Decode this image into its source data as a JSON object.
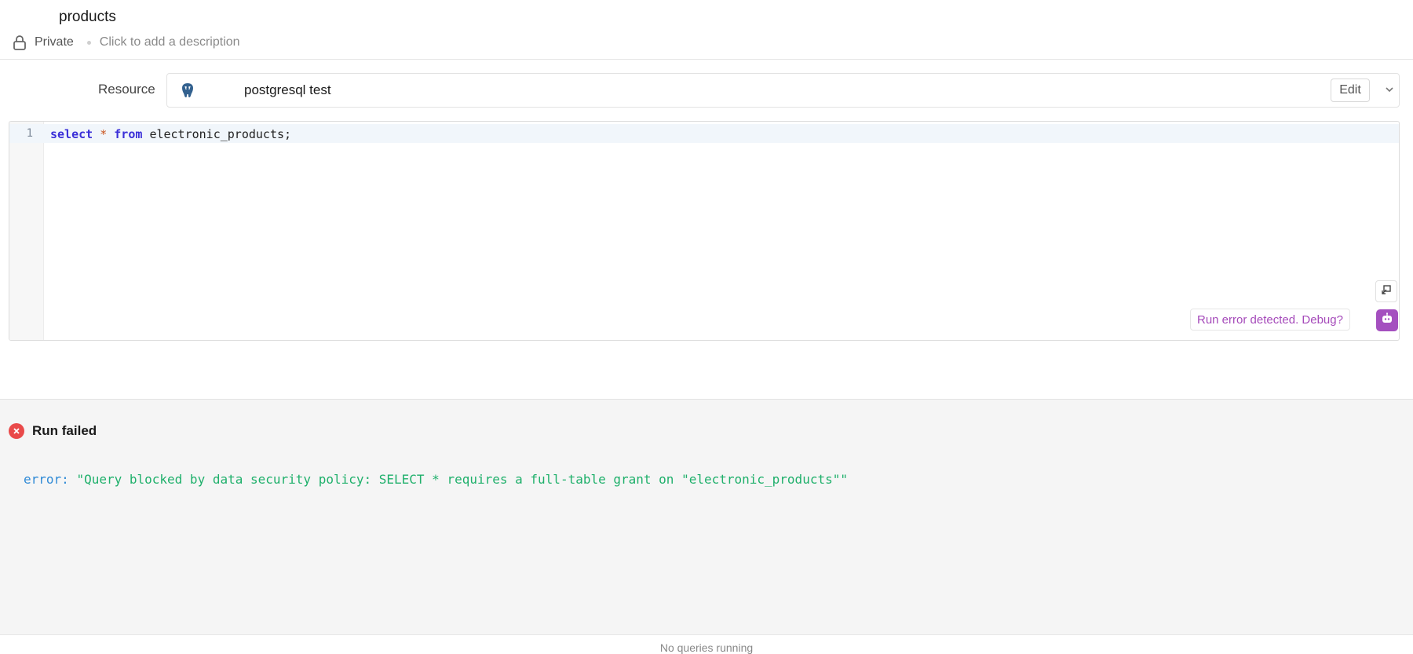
{
  "header": {
    "title": "products",
    "visibility": "Private",
    "description_placeholder": "Click to add a description"
  },
  "resource": {
    "label": "Resource",
    "name": "postgresql test",
    "edit_label": "Edit",
    "icon": "postgresql-elephant-icon"
  },
  "editor": {
    "line_number": "1",
    "code": {
      "kw_select": "select",
      "op_star": "*",
      "kw_from": "from",
      "table": "electronic_products;"
    },
    "debug_label": "Run error detected. Debug?"
  },
  "result": {
    "status": "Run failed",
    "error_key": "error:",
    "error_message": "\"Query blocked by data security policy: SELECT * requires a full-table grant on \"electronic_products\"\""
  },
  "footer": {
    "status": "No queries running"
  },
  "colors": {
    "keyword": "#3a2fd8",
    "operator": "#c9531c",
    "error_key": "#2f8ad6",
    "error_message": "#1fb06b",
    "debug_accent": "#a44fbf",
    "fail_red": "#e94a4a"
  }
}
